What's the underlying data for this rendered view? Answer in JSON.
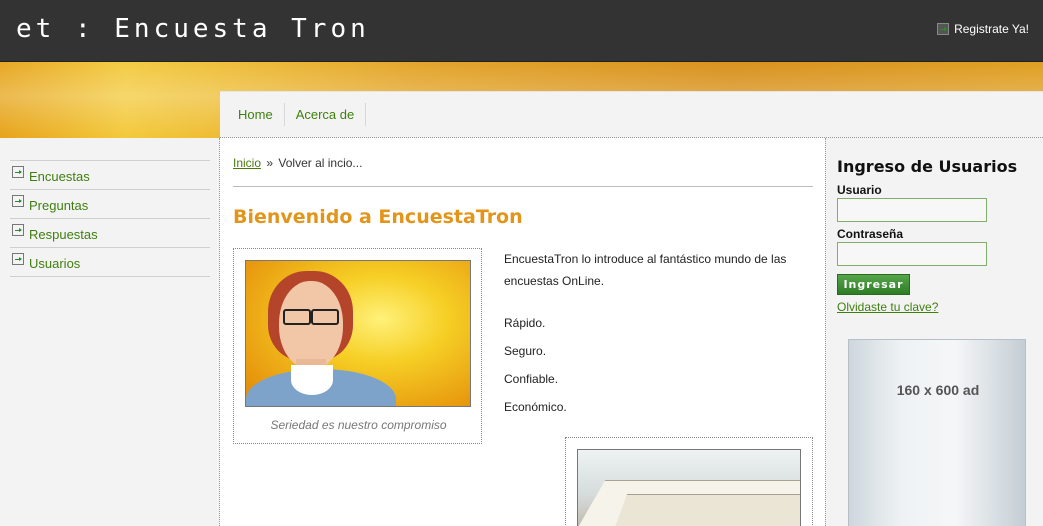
{
  "header": {
    "site_title": "et : Encuesta Tron",
    "register_label": "Registrate Ya!"
  },
  "nav": {
    "items": [
      {
        "label": "Home"
      },
      {
        "label": "Acerca de"
      }
    ]
  },
  "sidebar": {
    "items": [
      {
        "label": "Encuestas"
      },
      {
        "label": "Preguntas"
      },
      {
        "label": "Respuestas"
      },
      {
        "label": "Usuarios"
      }
    ]
  },
  "breadcrumb": {
    "home": "Inicio",
    "separator": "»",
    "current": "Volver al incio..."
  },
  "main": {
    "heading": "Bienvenido a EncuestaTron",
    "image_caption": "Seriedad es nuestro compromiso",
    "intro": "EncuestaTron lo introduce al fantástico mundo de las encuestas OnLine.",
    "features": [
      "Rápido.",
      "Seguro.",
      "Confiable.",
      "Económico."
    ]
  },
  "login": {
    "title": "Ingreso de Usuarios",
    "user_label": "Usuario",
    "user_value": "",
    "password_label": "Contraseña",
    "password_value": "",
    "button_label": "Ingresar",
    "forgot_label": "Olvidaste tu clave?"
  },
  "ad": {
    "text": "160 x 600 ad"
  },
  "colors": {
    "header_bg": "#333333",
    "link_green": "#3f7f0f",
    "heading_orange": "#e3951a",
    "button_green": "#3a8a30"
  }
}
